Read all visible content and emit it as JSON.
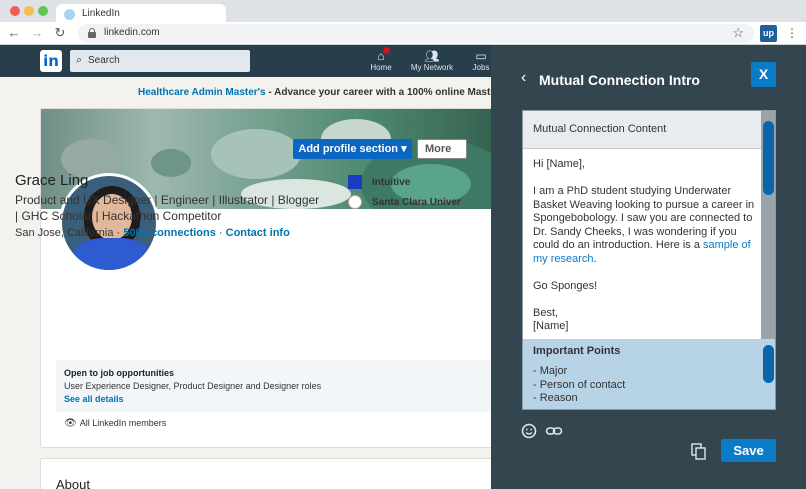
{
  "browser": {
    "tab_title": "LinkedIn",
    "url": "linkedin.com",
    "extension_label": "up"
  },
  "linkedin": {
    "logo": "in",
    "search_placeholder": "Search",
    "nav": {
      "home": "Home",
      "network": "My Network",
      "jobs": "Jobs"
    },
    "promo": {
      "link": "Healthcare Admin Master's",
      "text": " - Advance your career with a 100% online Master"
    },
    "profile": {
      "add_section": "Add profile section",
      "more": "More",
      "name": "Grace Ling",
      "headline": "Product and UX Designer | Engineer | Illustrator | Blogger | GHC Scholar | Hackathon Competitor",
      "location": "San Jose, California",
      "separator": " · ",
      "connections": "500+ connections",
      "contact": "Contact info",
      "companies": [
        "Intuitive",
        "Santa Clara Univer"
      ],
      "open_to_job": {
        "title": "Open to job opportunities",
        "roles": "User Experience Designer, Product Designer and Designer roles",
        "see_all": "See all details"
      },
      "visibility": "All LinkedIn members"
    },
    "about_title": "About"
  },
  "panel": {
    "back_glyph": "‹",
    "title": "Mutual Connection Intro",
    "close_label": "X",
    "content_header": "Mutual Connection Content",
    "greeting": "Hi [Name],",
    "body_text": "I am a PhD student studying Underwater Basket Weaving looking to pursue a career in Spongebobology. I saw you are connected to Dr. Sandy Cheeks, I was wondering if you could do an introduction. Here is a ",
    "body_link": "sample of my research",
    "body_end": ".",
    "signoff_1": "Go Sponges!",
    "signoff_2": "Best,",
    "signoff_3": "[Name]",
    "points_header": "Important Points",
    "points": [
      "- Major",
      "- Person of contact",
      "- Reason"
    ],
    "save_label": "Save"
  },
  "colors": {
    "panel_bg": "#33454f",
    "accent": "#0a7cc7",
    "linkedin_header": "#283e4a",
    "points_bg": "#b7d3e6"
  },
  "icons": [
    "back-icon",
    "forward-icon",
    "reload-icon",
    "lock-icon",
    "star-icon",
    "kebab-icon",
    "search-icon",
    "home-icon",
    "network-icon",
    "jobs-icon",
    "dropdown-icon",
    "eye-icon",
    "chevron-left-icon",
    "emoji-icon",
    "link-icon",
    "copy-icon"
  ]
}
